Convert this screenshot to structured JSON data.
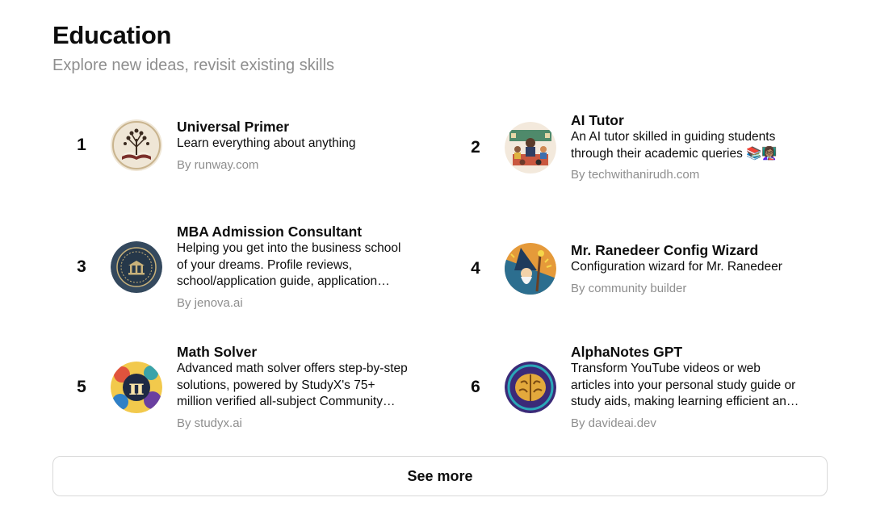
{
  "section": {
    "title": "Education",
    "subtitle": "Explore new ideas, revisit existing skills"
  },
  "items": [
    {
      "rank": "1",
      "name": "Universal Primer",
      "description": "Learn everything about anything",
      "author": "By runway.com",
      "icon": "book-tree-icon"
    },
    {
      "rank": "2",
      "name": "AI Tutor",
      "description": "An AI tutor skilled in guiding students through their academic queries 📚👩🏽‍🏫",
      "author": "By techwithanirudh.com",
      "icon": "classroom-icon"
    },
    {
      "rank": "3",
      "name": "MBA Admission Consultant",
      "description": "Helping you get into the business school of your dreams. Profile reviews, school/application guide, application essay help and more.",
      "author": "By jenova.ai",
      "icon": "university-seal-icon"
    },
    {
      "rank": "4",
      "name": "Mr. Ranedeer Config Wizard",
      "description": "Configuration wizard for Mr. Ranedeer",
      "author": "By community builder",
      "icon": "wizard-icon"
    },
    {
      "rank": "5",
      "name": "Math Solver",
      "description": "Advanced math solver offers step-by-step solutions, powered by StudyX's 75+ million verified all-subject Community answers and more.",
      "author": "By studyx.ai",
      "icon": "pi-symbol-icon"
    },
    {
      "rank": "6",
      "name": "AlphaNotes GPT",
      "description": "Transform YouTube videos or web articles into your personal study guide or study aids, making learning efficient and enjoyable.",
      "author": "By davideai.dev",
      "icon": "brain-icon"
    }
  ],
  "see_more_label": "See more"
}
